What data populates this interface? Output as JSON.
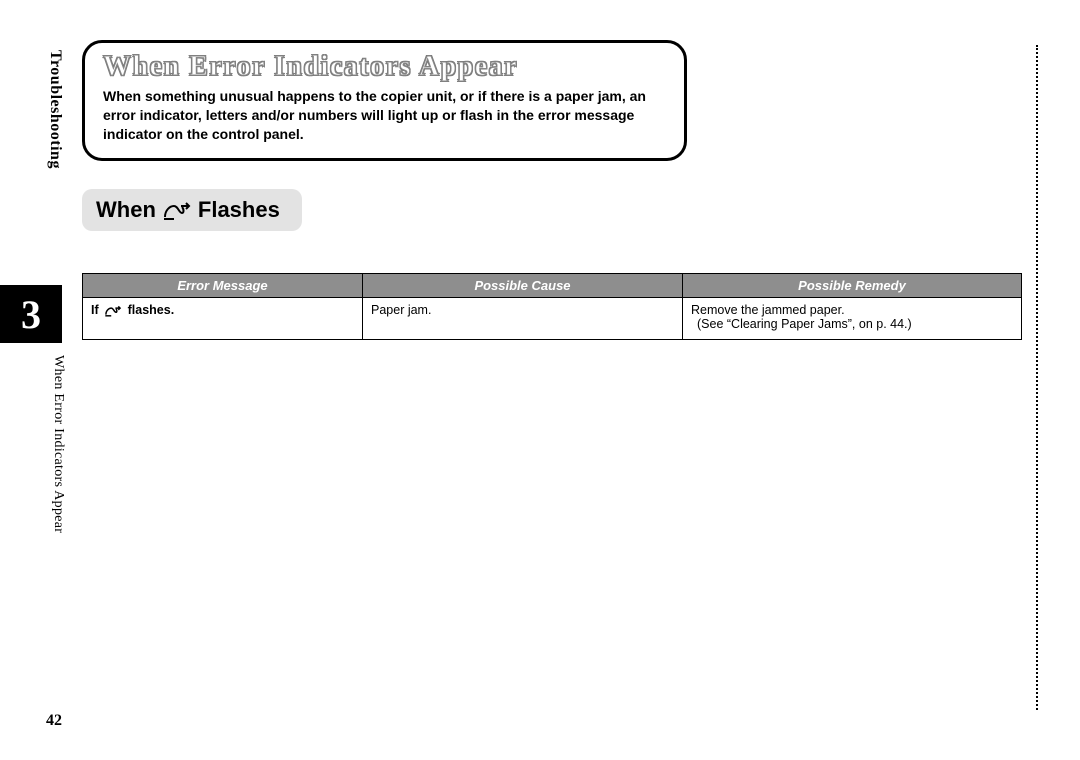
{
  "sidebar": {
    "section": "Troubleshooting",
    "chapter_number": "3",
    "chapter_title": "When Error Indicators Appear"
  },
  "page_number": "42",
  "title": {
    "heading": "When Error Indicators Appear",
    "description": "When something unusual happens to the copier unit, or if there is a paper jam, an error indicator, letters and/or numbers will light up or flash in the error message indicator on the control panel."
  },
  "subheading": {
    "prefix": "When",
    "suffix": "Flashes"
  },
  "table": {
    "headers": {
      "c1": "Error Message",
      "c2": "Possible Cause",
      "c3": "Possible Remedy"
    },
    "row": {
      "message_prefix": "If",
      "message_suffix": "flashes.",
      "cause": "Paper jam.",
      "remedy_line1": "Remove the jammed paper.",
      "remedy_line2": "(See “Clearing Paper Jams”, on p. 44.)"
    }
  }
}
